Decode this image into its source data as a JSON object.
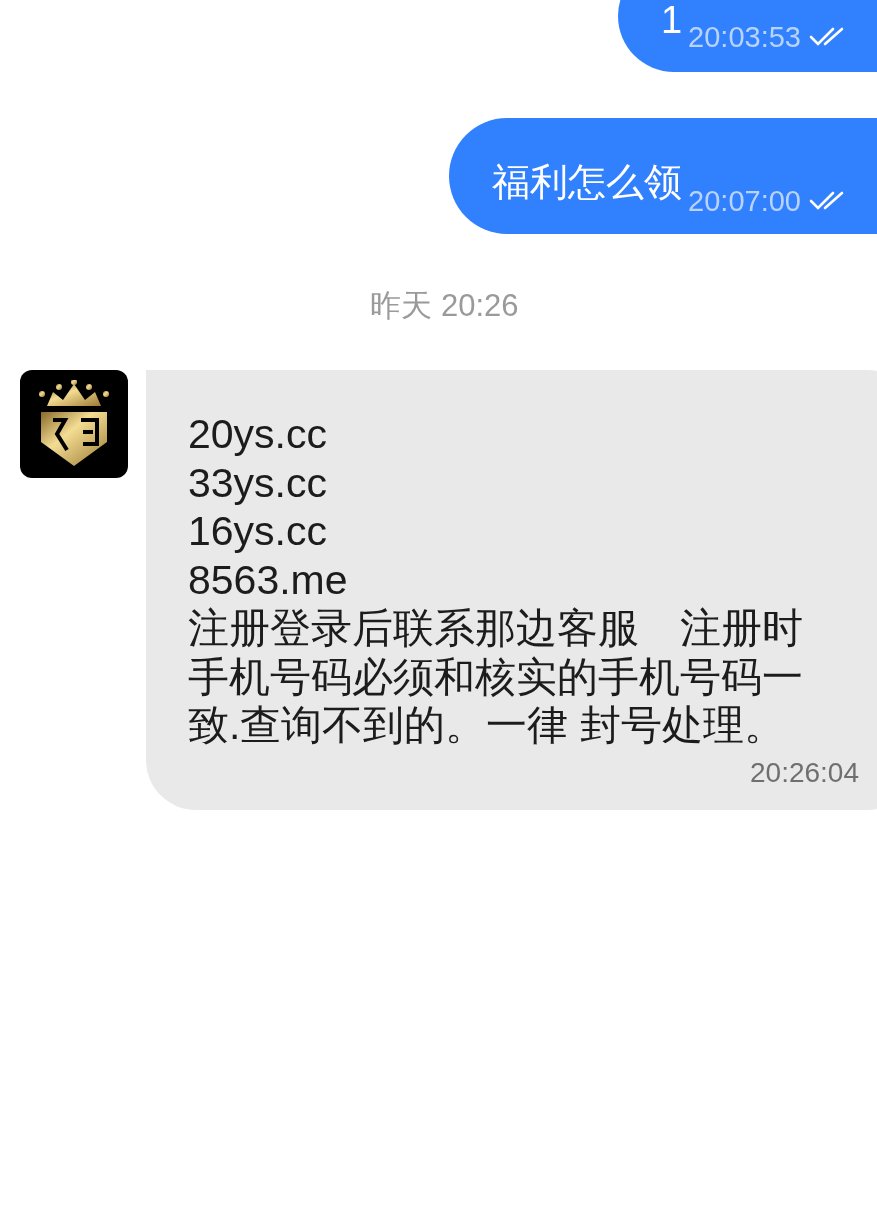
{
  "messages": [
    {
      "kind": "outgoing",
      "text": "1",
      "time": "20:03:53",
      "read": true
    },
    {
      "kind": "outgoing",
      "text": "福利怎么领",
      "time": "20:07:00",
      "read": true
    },
    {
      "kind": "date",
      "text": "昨天 20:26"
    },
    {
      "kind": "incoming",
      "text": "20ys.cc\n33ys.cc\n16ys.cc\n8563.me\n注册登录后联系那边客服　注册时手机号码必须和核实的手机号码一致.查询不到的。一律 封号处理。",
      "time": "20:26:04"
    }
  ]
}
